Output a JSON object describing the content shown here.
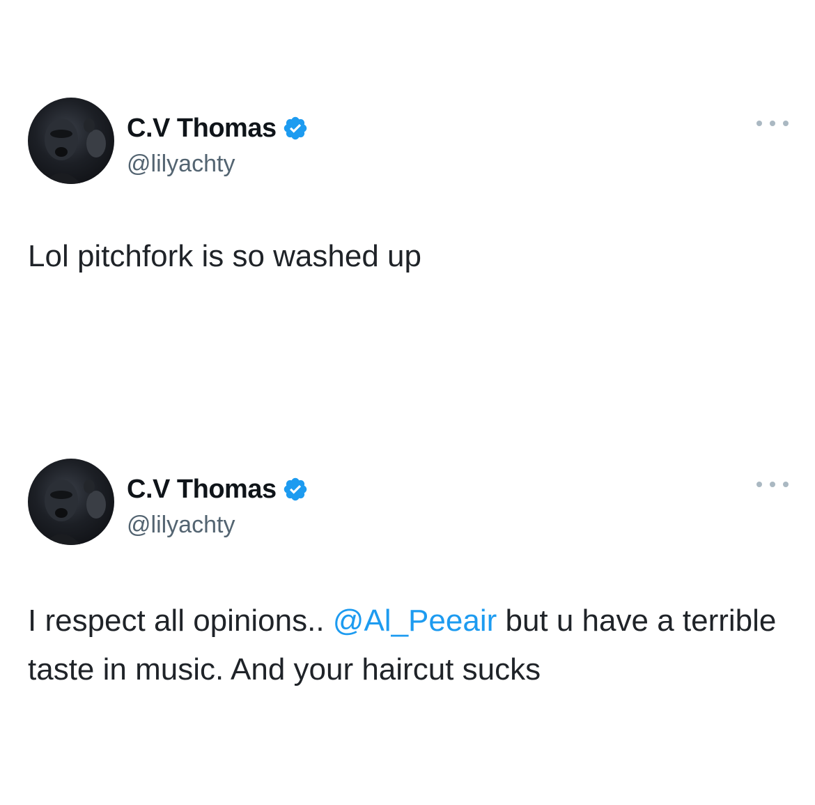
{
  "tweets": [
    {
      "display_name": "C.V Thomas",
      "handle": "@lilyachty",
      "verified": true,
      "text": "Lol pitchfork is so washed up"
    },
    {
      "display_name": "C.V Thomas",
      "handle": "@lilyachty",
      "verified": true,
      "text_before": "I respect all opinions.. ",
      "mention": "@Al_Peeair",
      "text_after": " but u have a terrible taste in music. And your haircut sucks"
    }
  ],
  "icons": {
    "verified": "verified-badge-icon",
    "more": "more-options-icon"
  },
  "colors": {
    "verified": "#1d9bf0",
    "mention": "#1d9bf0",
    "handle": "#536471",
    "text": "#0f1419"
  }
}
